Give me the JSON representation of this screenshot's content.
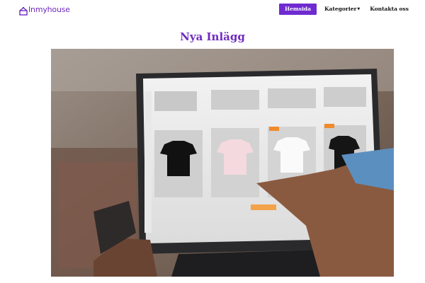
{
  "brand": {
    "name": "Inmyhouse",
    "icon": "house-icon",
    "color": "#6f2bbf"
  },
  "nav": {
    "items": [
      {
        "label": "Hemsida",
        "active": true
      },
      {
        "label": "Kategorier",
        "dropdown": true
      },
      {
        "label": "Kontakta oss"
      }
    ],
    "accent": "#6f2bd0"
  },
  "main": {
    "title": "Nya Inlägg"
  },
  "hero_image": {
    "subject": "person pointing at laptop screen showing an online t-shirt store"
  }
}
